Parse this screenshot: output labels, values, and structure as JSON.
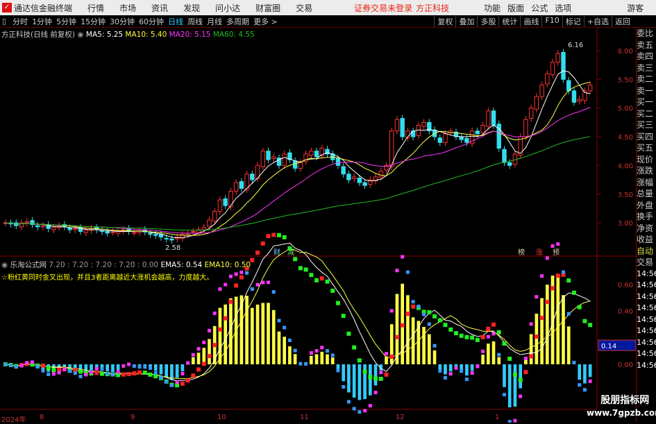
{
  "app": {
    "title": "通达信金融终端",
    "menus": [
      "行情",
      "市场",
      "资讯",
      "发现",
      "问小达",
      "财富圈",
      "交易"
    ],
    "warning": "证券交易未登录",
    "stock_name": "方正科技",
    "right_menus": [
      "功能",
      "版面",
      "公式",
      "选项"
    ],
    "guest": "游客"
  },
  "toolbar": {
    "periods": [
      "分时",
      "1分钟",
      "5分钟",
      "15分钟",
      "30分钟",
      "60分钟",
      "日线",
      "周线",
      "月线",
      "多周期",
      "更多 >"
    ],
    "active": "日线",
    "right": [
      "复权",
      "叠加",
      "多股",
      "统计",
      "画线",
      "F10",
      "标记",
      "+自选",
      "返回"
    ]
  },
  "info": {
    "title": "方正科技(日线 前复权)",
    "ma5": "MA5: 5.25",
    "ma10": "MA10: 5.40",
    "ma20": "MA20: 5.15",
    "ma60": "MA60: 4.55"
  },
  "colors": {
    "up": "#ff3333",
    "down": "#33ddee",
    "ma5": "#ffffff",
    "ma10": "#ffff44",
    "ma20": "#ff33ff",
    "ma60": "#22bb22",
    "axis": "#cc3333"
  },
  "price_axis": [
    "6.00",
    "5.50",
    "5.00",
    "4.50",
    "4.00",
    "3.50",
    "3.00"
  ],
  "annotations": {
    "high": "6.16",
    "low": "2.58",
    "markers": [
      "财",
      "减",
      "榜",
      "涨",
      "预"
    ]
  },
  "indicator": {
    "name": "乐淘公式网",
    "values": "7.20 : 7.20 : 7.20 : 7.20 : 0.00",
    "ema5": "EMA5: 0.54",
    "ema10": "EMA10: 0.50",
    "note": "☆粉红黄同时金叉出现，并且3者距离越近大涨机会越高，力度越大。",
    "axis": [
      "0.60",
      "0.40",
      "0.00"
    ],
    "current": "0.14"
  },
  "x_axis": {
    "year": "2024年",
    "months": [
      "8",
      "9",
      "10",
      "11",
      "12",
      "1"
    ]
  },
  "right_panel": [
    "委比",
    "卖五",
    "卖四",
    "卖三",
    "卖二",
    "卖一",
    "买一",
    "买二",
    "买三",
    "买四",
    "买五",
    "现价",
    "涨跌",
    "涨幅",
    "总量",
    "外盘",
    "换手",
    "净资",
    "收益",
    "自动",
    "交易",
    "14:56",
    "14:56",
    "14:56",
    "14:56",
    "14:56",
    "14:56",
    "14:56",
    "14:56",
    "14:56"
  ],
  "watermark": {
    "line1": "股朋指标网",
    "line2": "www.7gpzb.com"
  },
  "chart_data": {
    "type": "candlestick",
    "closes": [
      3.0,
      2.98,
      2.95,
      3.0,
      3.02,
      2.97,
      2.93,
      2.95,
      2.9,
      2.92,
      2.95,
      2.93,
      2.88,
      2.9,
      2.85,
      2.87,
      2.9,
      2.88,
      2.85,
      2.82,
      2.84,
      2.86,
      2.88,
      2.85,
      2.83,
      2.86,
      2.84,
      2.8,
      2.78,
      2.75,
      2.72,
      2.7,
      2.75,
      2.8,
      2.82,
      2.85,
      2.88,
      2.92,
      3.05,
      3.2,
      3.4,
      3.3,
      3.55,
      3.7,
      3.6,
      3.85,
      3.75,
      4.0,
      4.25,
      4.1,
      4.15,
      4.0,
      4.2,
      4.1,
      3.95,
      4.05,
      4.2,
      4.25,
      4.15,
      4.3,
      4.2,
      4.1,
      4.0,
      3.85,
      3.75,
      3.8,
      3.7,
      3.65,
      3.75,
      3.8,
      3.9,
      4.0,
      4.6,
      4.8,
      4.5,
      4.6,
      4.5,
      4.7,
      4.75,
      4.6,
      4.5,
      4.4,
      4.55,
      4.6,
      4.5,
      4.45,
      4.4,
      4.6,
      4.55,
      4.7,
      4.95,
      4.7,
      4.3,
      4.05,
      4.0,
      4.2,
      4.5,
      4.8,
      5.0,
      5.2,
      5.4,
      5.6,
      5.8,
      5.95,
      5.5,
      5.3,
      5.1,
      5.15,
      5.3,
      5.4
    ]
  }
}
